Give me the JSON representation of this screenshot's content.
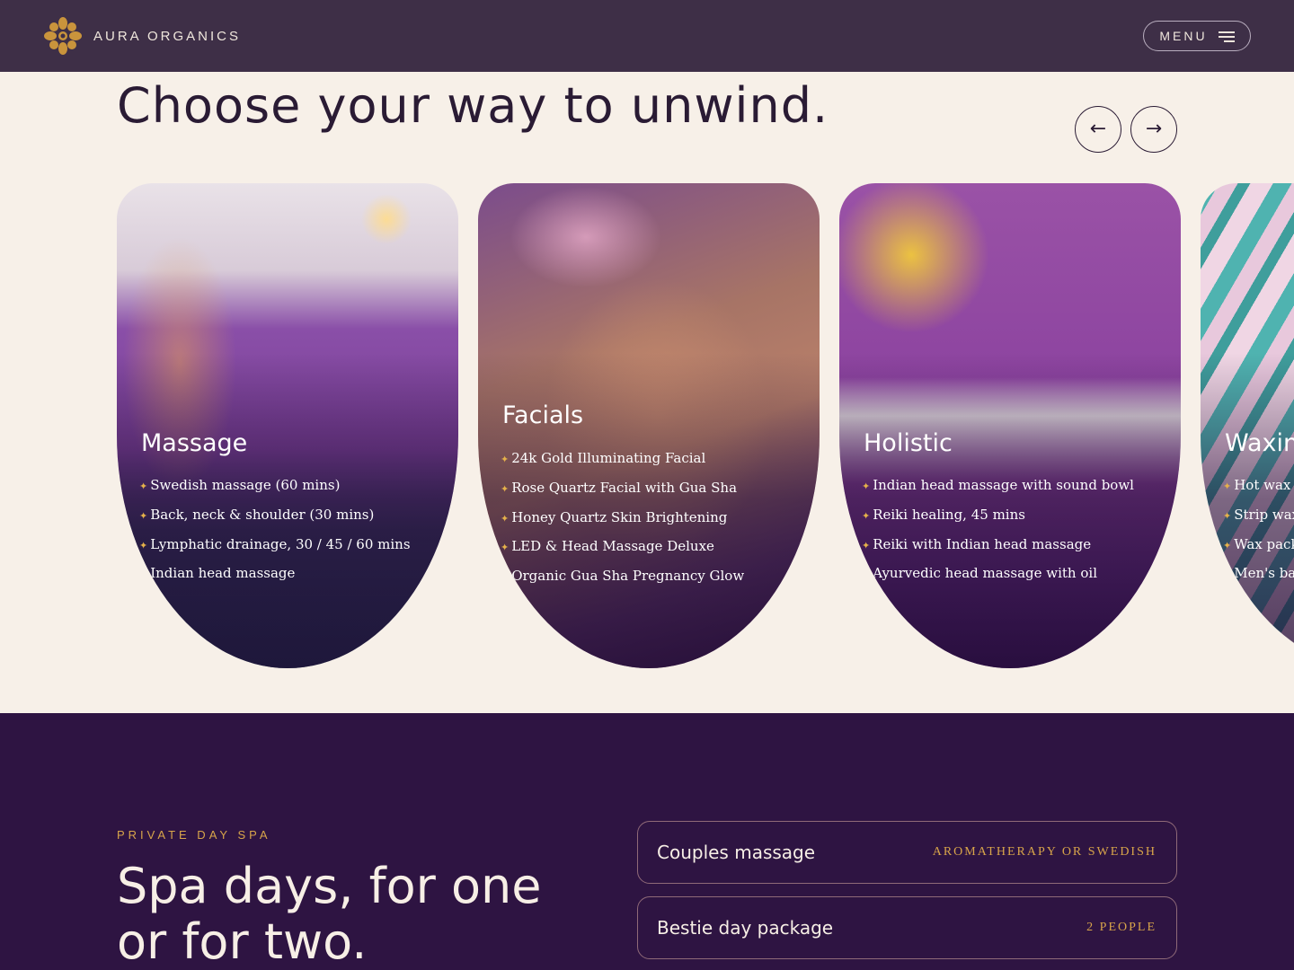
{
  "header": {
    "brand": "AURA ORGANICS",
    "logo_icon": "lotus-mandala-icon",
    "menu_label": "MENU",
    "menu_icon": "hamburger-icon"
  },
  "treatments": {
    "heading": "Choose your way to unwind.",
    "prev_icon": "arrow-left-icon",
    "next_icon": "arrow-right-icon",
    "cards": [
      {
        "title": "Massage",
        "items": [
          "Swedish massage (60 mins)",
          "Back, neck & shoulder (30 mins)",
          "Lymphatic drainage, 30 / 45 / 60 mins",
          "Indian head massage"
        ]
      },
      {
        "title": "Facials",
        "items": [
          "24k Gold Illuminating Facial",
          "Rose Quartz Facial with Gua Sha",
          "Honey Quartz Skin Brightening",
          "LED & Head Massage Deluxe",
          "Organic Gua Sha Pregnancy Glow"
        ]
      },
      {
        "title": "Holistic",
        "items": [
          "Indian head massage with sound bowl",
          "Reiki healing, 45 mins",
          "Reiki with Indian head massage",
          "Ayurvedic head massage with oil"
        ]
      },
      {
        "title": "Waxin",
        "items": [
          "Hot wax -",
          "Strip wax",
          "Wax pack",
          "Men's bac"
        ]
      }
    ]
  },
  "spa_days": {
    "eyebrow": "PRIVATE DAY SPA",
    "title": "Spa days, for one or for two.",
    "packages": [
      {
        "name": "Couples massage",
        "tag": "AROMATHERAPY OR SWEDISH"
      },
      {
        "name": "Bestie day package",
        "tag": "2 PEOPLE"
      }
    ]
  },
  "colors": {
    "header_bg": "#3e2f47",
    "page_bg": "#f7f0e8",
    "section_dark": "#2e1442",
    "accent_gold": "#d8a54a"
  }
}
